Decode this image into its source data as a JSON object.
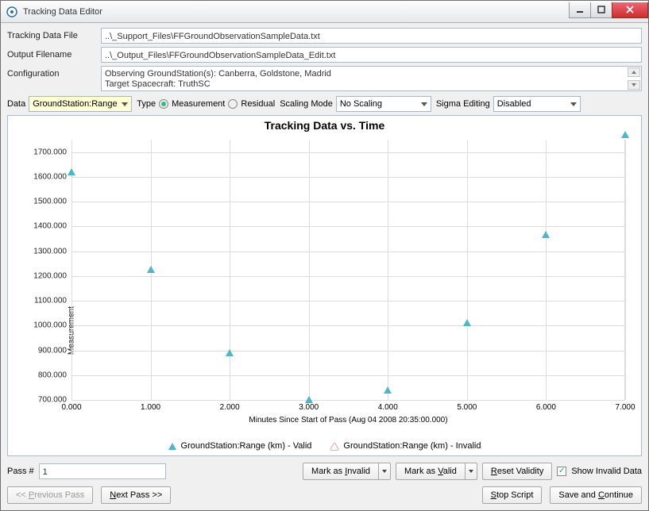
{
  "window": {
    "title": "Tracking Data Editor"
  },
  "fields": {
    "tracking_label": "Tracking Data File",
    "tracking_value": "..\\_Support_Files\\FFGroundObservationSampleData.txt",
    "output_label": "Output Filename",
    "output_value": "..\\_Output_Files\\FFGroundObservationSampleData_Edit.txt",
    "config_label": "Configuration",
    "config_line1": "Observing GroundStation(s): Canberra, Goldstone, Madrid",
    "config_line2": "Target Spacecraft: TruthSC"
  },
  "toolbar": {
    "data_label": "Data",
    "data_value": "GroundStation:Range",
    "type_label": "Type",
    "rb_meas": "Measurement",
    "rb_resid": "Residual",
    "scale_label": "Scaling Mode",
    "scale_value": "No Scaling",
    "sigma_label": "Sigma Editing",
    "sigma_value": "Disabled"
  },
  "chart_data": {
    "type": "scatter",
    "title": "Tracking Data vs. Time",
    "xlabel": "Minutes Since Start of Pass (Aug 04 2008 20:35:00.000)",
    "ylabel": "Measurement",
    "xlim": [
      0,
      7.0
    ],
    "ylim": [
      700,
      1750
    ],
    "xticks": [
      "0.000",
      "1.000",
      "2.000",
      "3.000",
      "4.000",
      "5.000",
      "6.000",
      "7.000"
    ],
    "yticks": [
      "700.000",
      "800.000",
      "900.000",
      "1000.000",
      "1100.000",
      "1200.000",
      "1300.000",
      "1400.000",
      "1500.000",
      "1600.000",
      "1700.000"
    ],
    "series": [
      {
        "name": "GroundStation:Range (km) - Valid",
        "x": [
          0.0,
          1.0,
          2.0,
          3.0,
          4.0,
          5.0,
          6.0,
          7.0
        ],
        "y": [
          1618,
          1225,
          890,
          700,
          740,
          1010,
          1367,
          1770
        ]
      },
      {
        "name": "GroundStation:Range (km) - Invalid",
        "x": [],
        "y": []
      }
    ]
  },
  "bottom": {
    "pass_label": "Pass #",
    "pass_value": "1",
    "mark_invalid": "Mark as Invalid",
    "mark_valid": "Mark as Valid",
    "reset": "Reset Validity",
    "show_invalid": "Show Invalid Data",
    "prev": "<< Previous Pass",
    "next": "Next Pass >>",
    "stop": "Stop Script",
    "save": "Save and Continue"
  }
}
